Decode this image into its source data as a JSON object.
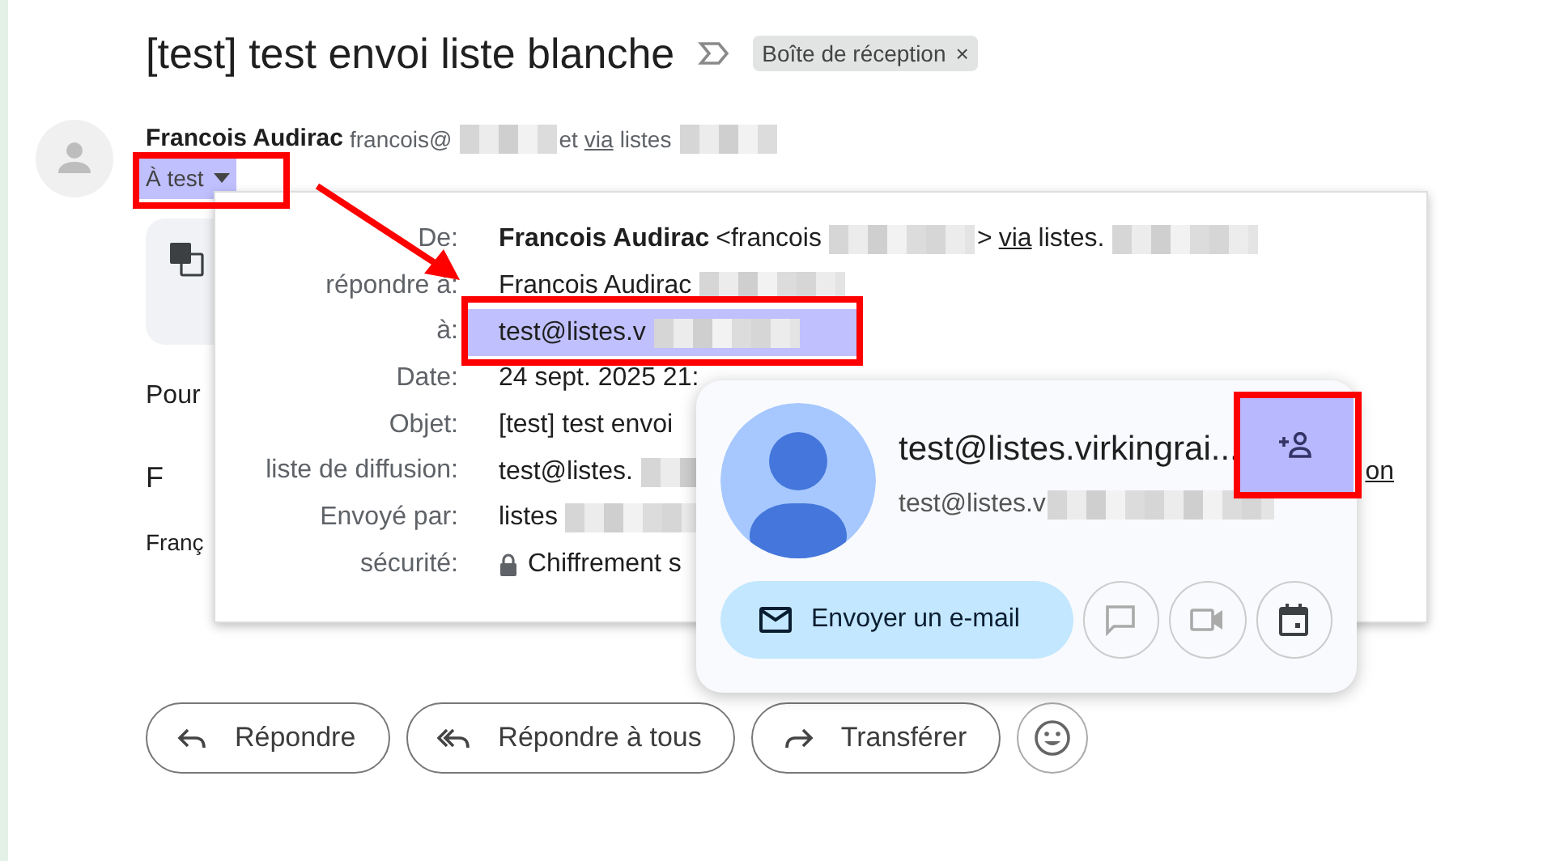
{
  "subject": "[test] test envoi liste blanche",
  "label": {
    "text": "Boîte de réception",
    "close": "×"
  },
  "sender": {
    "name": "Francois Audirac",
    "parts": [
      {
        "kind": "text",
        "text": "francois@"
      },
      {
        "kind": "redacted"
      },
      {
        "kind": "text",
        "text": "et"
      },
      {
        "kind": "link",
        "text": "via"
      },
      {
        "kind": "text",
        "text": "listes"
      },
      {
        "kind": "redacted"
      }
    ]
  },
  "recipient": {
    "text": "À test"
  },
  "body": [
    "Pour",
    "F",
    "Franç"
  ],
  "details": [
    {
      "label": "De:",
      "highlighted": false,
      "parts": [
        {
          "kind": "bold",
          "text": "Francois Audirac"
        },
        {
          "kind": "text",
          "text": "<francois"
        },
        {
          "kind": "redacted"
        },
        {
          "kind": "text",
          "text": ">"
        },
        {
          "kind": "link",
          "text": "via"
        },
        {
          "kind": "text",
          "text": "listes."
        },
        {
          "kind": "redacted"
        }
      ]
    },
    {
      "label": "répondre à:",
      "highlighted": false,
      "parts": [
        {
          "kind": "text",
          "text": "Francois Audirac"
        },
        {
          "kind": "redacted"
        }
      ]
    },
    {
      "label": "à:",
      "highlighted": true,
      "parts": [
        {
          "kind": "text",
          "text": "test@listes.v"
        },
        {
          "kind": "redacted"
        }
      ]
    },
    {
      "label": "Date:",
      "highlighted": false,
      "parts": [
        {
          "kind": "text",
          "text": "24 sept. 2025 21:"
        }
      ]
    },
    {
      "label": "Objet:",
      "highlighted": false,
      "parts": [
        {
          "kind": "text",
          "text": "[test] test envoi"
        }
      ]
    },
    {
      "label": "liste de diffusion:",
      "highlighted": false,
      "parts": [
        {
          "kind": "text",
          "text": "test@listes."
        },
        {
          "kind": "redacted"
        },
        {
          "kind": "link",
          "text": "on"
        }
      ]
    },
    {
      "label": "Envoyé par:",
      "highlighted": false,
      "parts": [
        {
          "kind": "text",
          "text": "listes"
        },
        {
          "kind": "redacted"
        }
      ]
    },
    {
      "label": "sécurité:",
      "highlighted": false,
      "parts": [
        {
          "kind": "lock"
        },
        {
          "kind": "text",
          "text": "Chiffrement s"
        }
      ]
    }
  ],
  "contact_card": {
    "name": "test@listes.virkingrai...",
    "email": "test@listes.v",
    "send_button": "Envoyer un e-mail"
  },
  "actions": [
    {
      "kind": "reply",
      "label": "Répondre"
    },
    {
      "kind": "reply_all",
      "label": "Répondre à tous"
    },
    {
      "kind": "forward",
      "label": "Transférer"
    },
    {
      "kind": "emoji"
    }
  ]
}
